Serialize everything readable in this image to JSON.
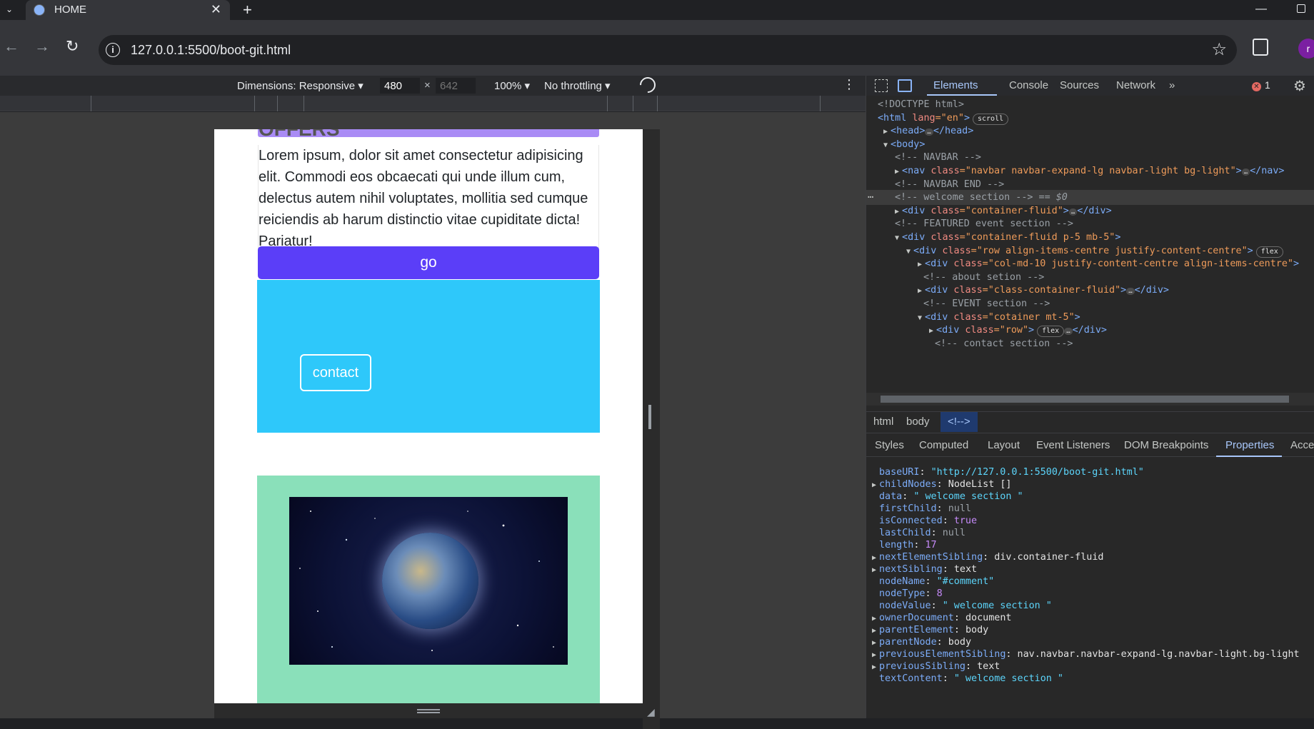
{
  "browser": {
    "tab_title": "HOME",
    "tab_close": "✕",
    "new_tab": "+",
    "url": "127.0.0.1:5500/boot-git.html"
  },
  "device_toolbar": {
    "dimensions_label": "Dimensions: Responsive ▾",
    "width": "480",
    "times": "×",
    "height_placeholder": "642",
    "zoom": "100% ▾",
    "throttling": "No throttling ▾"
  },
  "page": {
    "offers_heading": "OFFERS",
    "lorem": "Lorem ipsum, dolor sit amet consectetur adipisicing elit. Commodi eos obcaecati qui unde illum cum, delectus autem nihil voluptates, mollitia sed cumque reiciendis ab harum distinctio vitae cupiditate dicta! Pariatur!",
    "go_label": "go",
    "contact_label": "contact",
    "colors": {
      "heading_bg": "#a98bf5",
      "go_bg": "#5b3ef8",
      "contact_section_bg": "#2ec8fa",
      "image_section_bg": "#8ae0ba"
    }
  },
  "devtools": {
    "tabs": [
      "Elements",
      "Console",
      "Sources",
      "Network",
      "»"
    ],
    "error_count": "1",
    "error_x": "✕",
    "dom": [
      {
        "c": "<!DOCTYPE html>"
      },
      {
        "tag": "<html",
        "a": " lang",
        "v": "=\"en\"",
        "end": ">",
        "pill": "scroll"
      },
      {
        "tag": "<head>",
        "dots": "…",
        "end": "</head>"
      },
      {
        "tag": "<body>"
      },
      {
        "c": "<!-- NAVBAR -->"
      },
      {
        "tag": "<nav",
        "a": " class",
        "v": "=\"navbar navbar-expand-lg navbar-light bg-light\"",
        "end": ">",
        "dots": "…",
        "end2": "</nav>"
      },
      {
        "c": "<!-- NAVBAR END -->"
      },
      {
        "c": "<!-- welcome section -->",
        "eq": " == $0"
      },
      {
        "tag": "<div",
        "a": " class",
        "v": "=\"container-fluid\"",
        "end": ">",
        "dots": "…",
        "end2": "</div>"
      },
      {
        "c": "<!--  FEATURED event section -->"
      },
      {
        "tag": "<div",
        "a": " class",
        "v": "=\"container-fluid p-5 mb-5\"",
        "end": ">"
      },
      {
        "tag": "<div",
        "a": " class",
        "v": "=\"row align-items-centre justify-content-centre\"",
        "end": ">",
        "pill": "flex"
      },
      {
        "tag": "<div",
        "a": " class",
        "v": "=\"col-md-10 justify-content-centre align-items-centre\"",
        "end": ">"
      },
      {
        "c": "<!-- about setion -->"
      },
      {
        "tag": "<div",
        "a": " class",
        "v": "=\"class-container-fluid\"",
        "end": ">",
        "dots": "…",
        "end2": "</div>"
      },
      {
        "c": "<!-- EVENT section -->"
      },
      {
        "tag": "<div",
        "a": " class",
        "v": "=\"cotainer mt-5\"",
        "end": ">"
      },
      {
        "tag": "<div",
        "a": " class",
        "v": "=\"row\"",
        "end": ">",
        "dots": "…",
        "end2": "</div>",
        "pill": "flex"
      },
      {
        "c": "<!-- contact section -->"
      }
    ],
    "breadcrumbs": [
      "html",
      "body",
      "<!-->"
    ],
    "side_tabs": [
      "Styles",
      "Computed",
      "Layout",
      "Event Listeners",
      "DOM Breakpoints",
      "Properties",
      "Acce"
    ],
    "properties": [
      {
        "k": "baseURI",
        "v": "\"http://127.0.0.1:5500/boot-git.html\"",
        "t": "s"
      },
      {
        "k": "childNodes",
        "v": "NodeList []",
        "t": "v",
        "exp": true
      },
      {
        "k": "data",
        "v": "\" welcome section \"",
        "t": "s"
      },
      {
        "k": "firstChild",
        "v": "null",
        "t": "null"
      },
      {
        "k": "isConnected",
        "v": "true",
        "t": "n"
      },
      {
        "k": "lastChild",
        "v": "null",
        "t": "null"
      },
      {
        "k": "length",
        "v": "17",
        "t": "n"
      },
      {
        "k": "nextElementSibling",
        "v": "div.container-fluid",
        "t": "v",
        "exp": true
      },
      {
        "k": "nextSibling",
        "v": "text",
        "t": "v",
        "exp": true
      },
      {
        "k": "nodeName",
        "v": "\"#comment\"",
        "t": "s"
      },
      {
        "k": "nodeType",
        "v": "8",
        "t": "n"
      },
      {
        "k": "nodeValue",
        "v": "\" welcome section \"",
        "t": "s"
      },
      {
        "k": "ownerDocument",
        "v": "document",
        "t": "v",
        "exp": true
      },
      {
        "k": "parentElement",
        "v": "body",
        "t": "v",
        "exp": true
      },
      {
        "k": "parentNode",
        "v": "body",
        "t": "v",
        "exp": true
      },
      {
        "k": "previousElementSibling",
        "v": "nav.navbar.navbar-expand-lg.navbar-light.bg-light",
        "t": "v",
        "exp": true
      },
      {
        "k": "previousSibling",
        "v": "text",
        "t": "v",
        "exp": true
      },
      {
        "k": "textContent",
        "v": "\" welcome section \"",
        "t": "s"
      }
    ]
  }
}
